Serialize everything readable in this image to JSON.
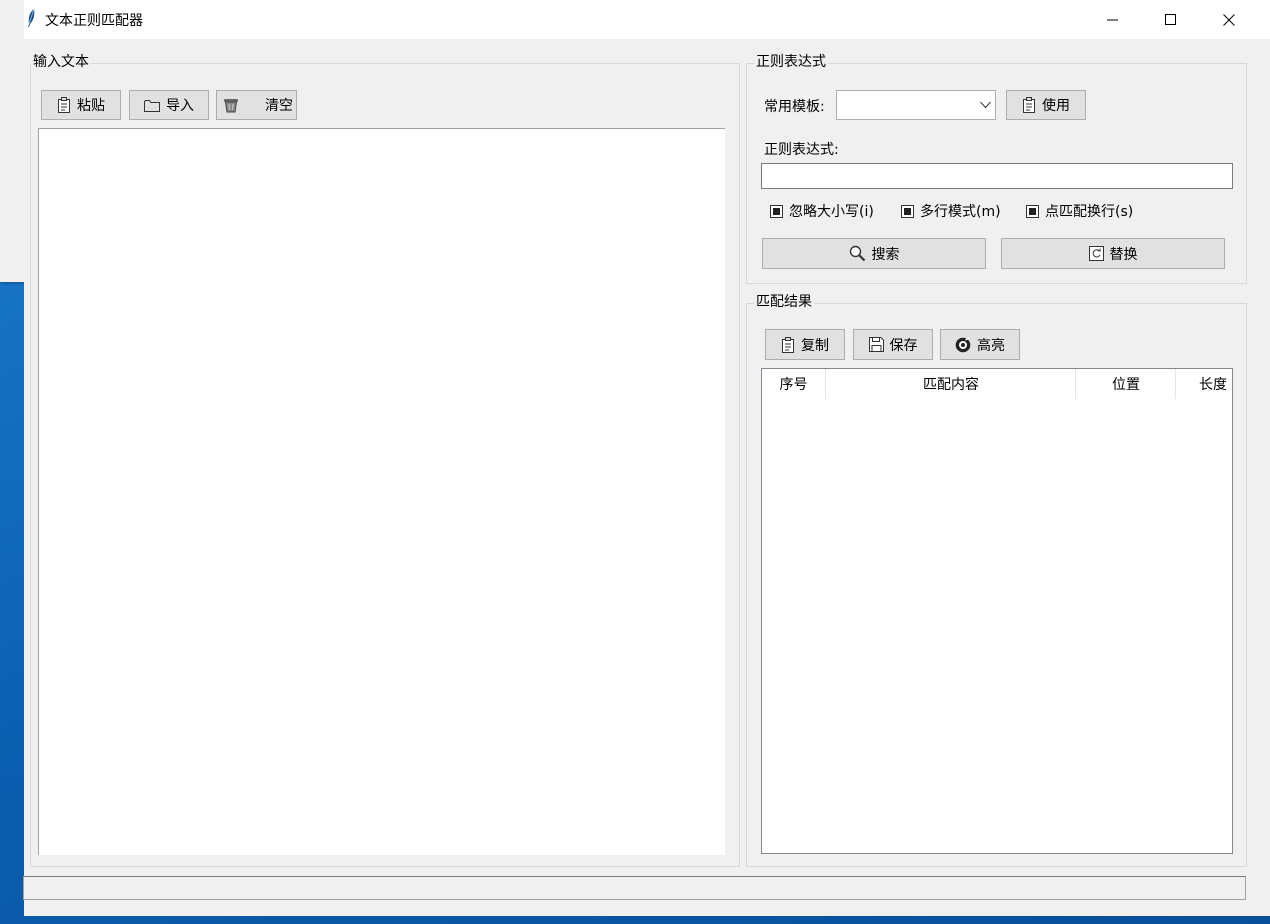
{
  "window": {
    "title": "文本正则匹配器"
  },
  "input_panel": {
    "legend": "输入文本",
    "buttons": {
      "paste": "粘贴",
      "import": "导入",
      "clear": "清空"
    }
  },
  "regex_panel": {
    "legend": "正则表达式",
    "template_label": "常用模板:",
    "template_value": "",
    "use_button": "使用",
    "expr_label": "正则表达式:",
    "expr_value": "",
    "options": {
      "ignore_case": {
        "label": "忽略大小写(i)",
        "checked": true
      },
      "multiline": {
        "label": "多行模式(m)",
        "checked": true
      },
      "dotall": {
        "label": "点匹配换行(s)",
        "checked": true
      }
    },
    "search_button": "搜索",
    "replace_button": "替换"
  },
  "results_panel": {
    "legend": "匹配结果",
    "buttons": {
      "copy": "复制",
      "save": "保存",
      "highlight": "高亮"
    },
    "columns": [
      "序号",
      "匹配内容",
      "位置",
      "长度"
    ],
    "rows": []
  },
  "status_bar": {
    "text": ""
  },
  "colors": {
    "desktop": "#0b5fb0",
    "window_bg": "#f0f0f0",
    "button_bg": "#e1e1e1"
  }
}
